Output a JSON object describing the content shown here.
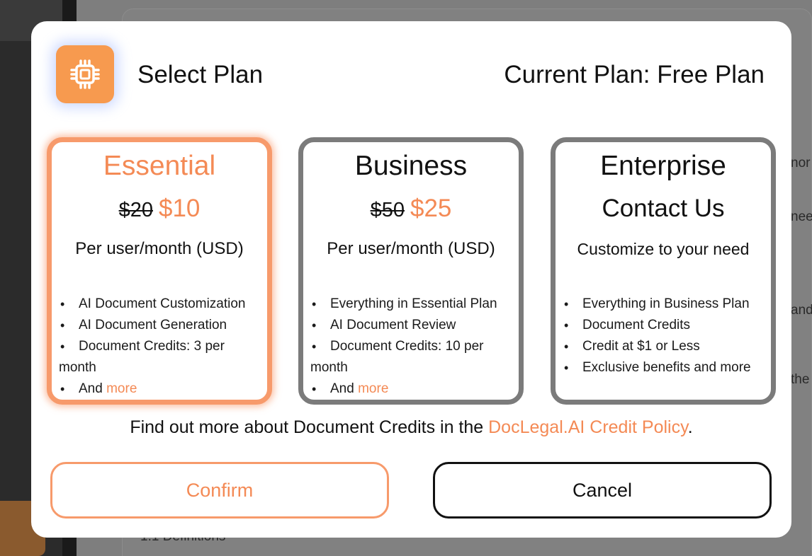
{
  "background": {
    "fragments": [
      "nor",
      "nee",
      "and",
      "the",
      "1.1 Definitions"
    ]
  },
  "modal": {
    "logo_icon": "chip-icon",
    "title": "Select Plan",
    "current_plan": "Current Plan: Free Plan"
  },
  "plans": {
    "essential": {
      "name": "Essential",
      "old_price": "$20",
      "price": "$10",
      "subtitle": "Per user/month (USD)",
      "features": [
        "AI Document Customization",
        "AI Document Generation",
        "Document Credits: 3 per month"
      ],
      "more_prefix": "And",
      "more_link": "more",
      "selected": true
    },
    "business": {
      "name": "Business",
      "old_price": "$50",
      "price": "$25",
      "subtitle": "Per user/month (USD)",
      "features": [
        "Everything in Essential Plan",
        "AI Document Review",
        "Document Credits: 10 per month"
      ],
      "more_prefix": "And",
      "more_link": "more",
      "selected": false
    },
    "enterprise": {
      "name": "Enterprise",
      "contact": "Contact Us",
      "subtitle": "Customize to your need",
      "features": [
        "Everything in Business Plan",
        "Document Credits",
        "Credit at $1 or Less",
        "Exclusive benefits and more"
      ],
      "selected": false
    }
  },
  "credit_note": {
    "prefix": "Find out more about Document Credits in the ",
    "link": "DocLegal.AI Credit Policy",
    "suffix": "."
  },
  "buttons": {
    "confirm": "Confirm",
    "cancel": "Cancel"
  },
  "colors": {
    "accent": "#f48a55",
    "selected_border": "#f79a6b",
    "card_border": "#7b7b7b",
    "logo_bg": "#f79a4f"
  }
}
